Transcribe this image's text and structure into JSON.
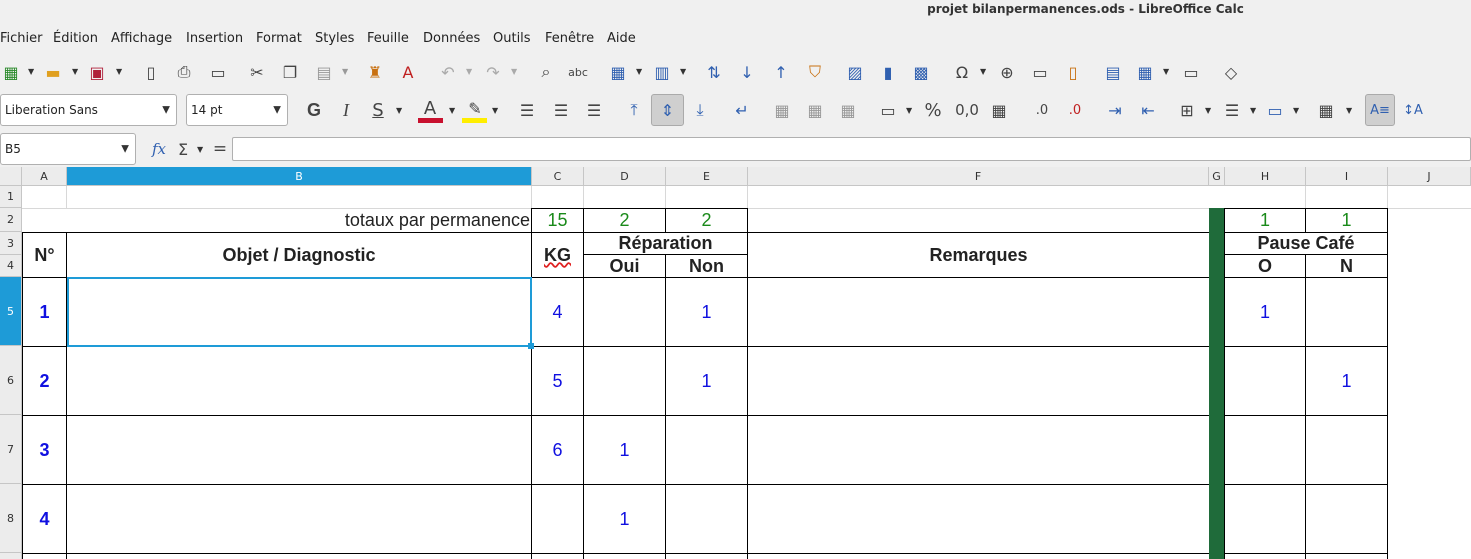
{
  "window": {
    "title": "projet bilanpermanences.ods - LibreOffice Calc"
  },
  "menu": [
    "Fichier",
    "Édition",
    "Affichage",
    "Insertion",
    "Format",
    "Styles",
    "Feuille",
    "Données",
    "Outils",
    "Fenêtre",
    "Aide"
  ],
  "format_bar": {
    "font_name": "Liberation Sans",
    "font_size": "14 pt",
    "bold": "G",
    "italic": "I",
    "underline": "S",
    "percent": "%",
    "number": "0,0"
  },
  "formula_bar": {
    "name_box": "B5",
    "fx": "fx",
    "sum": "Σ",
    "equals": "=",
    "content": ""
  },
  "columns": [
    "A",
    "B",
    "C",
    "D",
    "E",
    "F",
    "G",
    "H",
    "I",
    "J"
  ],
  "rows": [
    "1",
    "2",
    "3",
    "4",
    "5",
    "6",
    "7",
    "8"
  ],
  "sheet": {
    "totals_label": "totaux par permanence",
    "totals": {
      "kg": "15",
      "oui": "2",
      "non": "2",
      "o": "1",
      "n": "1"
    },
    "headers": {
      "num": "N°",
      "objet": "Objet / Diagnostic",
      "kg": "KG",
      "reparation": "Réparation",
      "oui": "Oui",
      "non": "Non",
      "remarques": "Remarques",
      "pause": "Pause Café",
      "o": "O",
      "n": "N"
    },
    "data": [
      {
        "num": "1",
        "kg": "4",
        "oui": "",
        "non": "1",
        "o": "1",
        "n": ""
      },
      {
        "num": "2",
        "kg": "5",
        "oui": "",
        "non": "1",
        "o": "",
        "n": "1"
      },
      {
        "num": "3",
        "kg": "6",
        "oui": "1",
        "non": "",
        "o": "",
        "n": ""
      },
      {
        "num": "4",
        "kg": "",
        "oui": "1",
        "non": "",
        "o": "",
        "n": ""
      }
    ]
  },
  "colors": {
    "selection": "#1e9bd7",
    "separator": "#1f6b3a",
    "data_blue": "#1010e0",
    "totals_green": "#1a8a1a"
  }
}
